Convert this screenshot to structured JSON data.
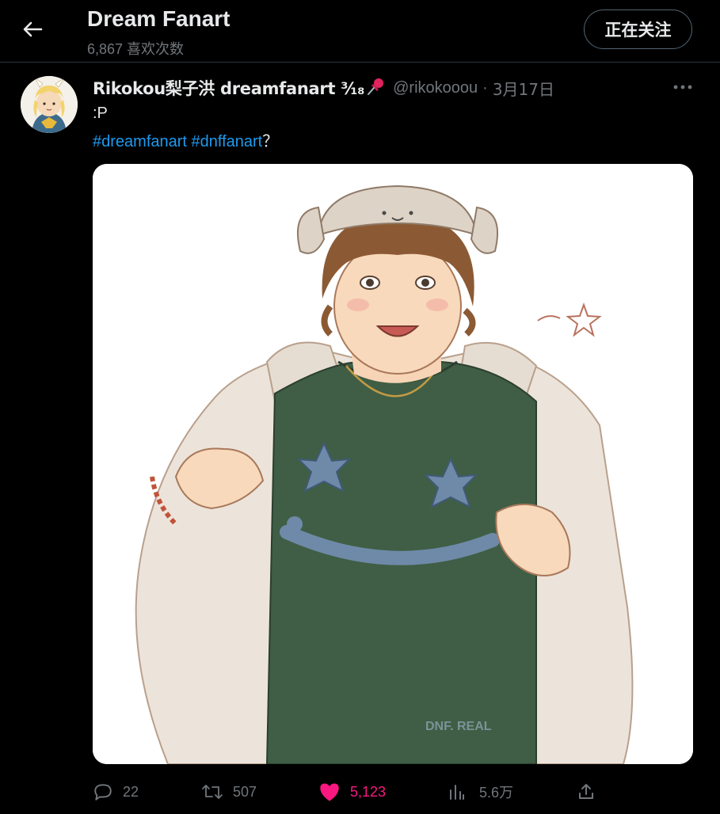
{
  "header": {
    "title": "Dream Fanart",
    "subtitle": "6,867 喜欢次数",
    "follow_label": "正在关注"
  },
  "tweet": {
    "author_name": "Rikokou梨子洪 dreamfanart ³⁄₁₈",
    "handle": "@rikokooou",
    "separator": "·",
    "date": "3月17日",
    "text": ":P",
    "hashtags": [
      "#dreamfanart",
      "#dnffanart"
    ],
    "hashtag_suffix": "？",
    "watermark": "DNF. REAL",
    "actions": {
      "replies": "22",
      "retweets": "507",
      "likes": "5,123",
      "views": "5.6万"
    }
  },
  "colors": {
    "background": "#000000",
    "text_primary": "#e7e9ea",
    "text_secondary": "#71767b",
    "link": "#1d9bf0",
    "like": "#f91880",
    "divider": "#2f3336"
  },
  "icons": {
    "back": "arrow-left-icon",
    "more": "more-horizontal-icon",
    "pin": "pushpin-icon",
    "reply": "reply-icon",
    "retweet": "retweet-icon",
    "like": "heart-filled-icon",
    "views": "bar-chart-icon",
    "share": "share-icon"
  }
}
